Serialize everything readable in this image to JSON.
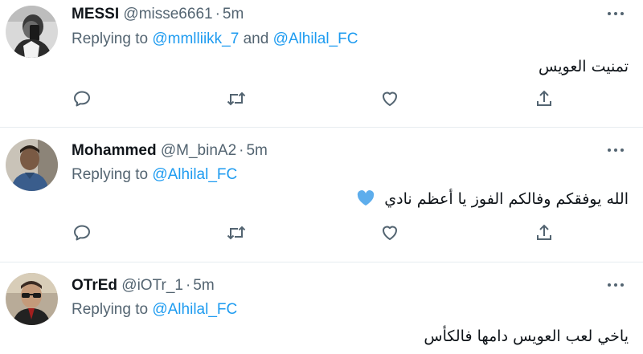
{
  "tweets": [
    {
      "name": "MESSI",
      "handle": "@misse6661",
      "dot": "·",
      "time": "5m",
      "replying_prefix": "Replying to ",
      "mentions": [
        "@mmlliikk_7",
        "@Alhilal_FC"
      ],
      "mention_joiner": " and ",
      "text": "تمنيت العويس",
      "avatar": "avatar-man-holding-phone"
    },
    {
      "name": "Mohammed",
      "handle": "@M_binA2",
      "dot": "·",
      "time": "5m",
      "replying_prefix": "Replying to ",
      "mentions": [
        "@Alhilal_FC"
      ],
      "text": "الله يوفقكم وفالكم الفوز يا أعظم نادي",
      "emoji": "blue-heart-icon",
      "avatar": "avatar-man-blue-shirt"
    },
    {
      "name": "OTrEd",
      "handle": "@iOTr_1",
      "dot": "·",
      "time": "5m",
      "replying_prefix": "Replying to ",
      "mentions": [
        "@Alhilal_FC"
      ],
      "text": "ياخي لعب العويس دامها فالكأس",
      "avatar": "avatar-man-sunglasses"
    }
  ],
  "icons": {
    "more": "more-horizontal-icon",
    "reply": "reply-icon",
    "retweet": "retweet-icon",
    "like": "heart-icon",
    "share": "share-icon"
  },
  "colors": {
    "link": "#1d9bf0",
    "secondary_text": "#536471",
    "icon": "#536471",
    "divider": "#e6ecf0",
    "heart_emoji": "#5dadec"
  }
}
